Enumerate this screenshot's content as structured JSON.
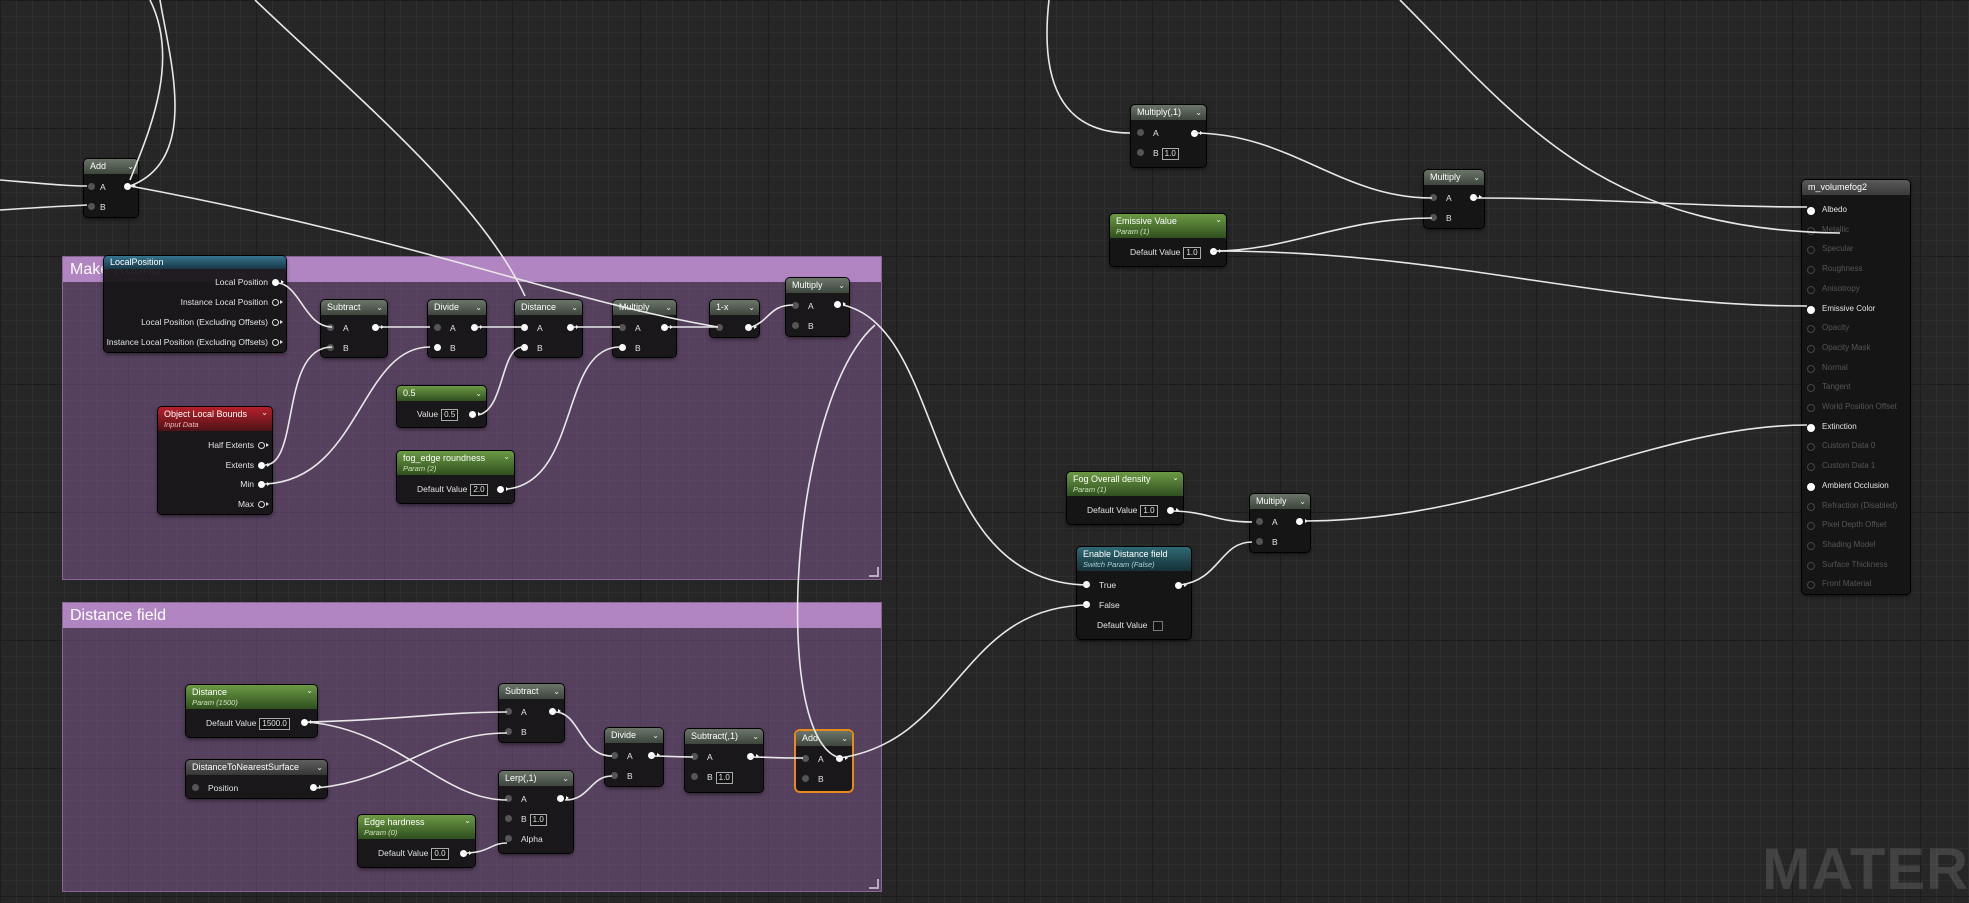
{
  "watermark": "MATER",
  "comments": {
    "make_round": "Make Round",
    "distance_field": "Distance field"
  },
  "nodes": {
    "add_top": {
      "title": "Add",
      "a": "A",
      "b": "B"
    },
    "local_position": {
      "title": "LocalPosition",
      "outputs": [
        "Local Position",
        "Instance Local Position",
        "Local Position (Excluding Offsets)",
        "Instance Local Position (Excluding Offsets)"
      ]
    },
    "subtract1": {
      "title": "Subtract",
      "a": "A",
      "b": "B"
    },
    "divide1": {
      "title": "Divide",
      "a": "A",
      "b": "B"
    },
    "distance1": {
      "title": "Distance",
      "a": "A",
      "b": "B"
    },
    "multiply1": {
      "title": "Multiply",
      "a": "A",
      "b": "B"
    },
    "one_minus": {
      "title": "1-x"
    },
    "multiply2": {
      "title": "Multiply",
      "a": "A",
      "b": "B"
    },
    "const_05": {
      "title": "0.5",
      "label": "Value",
      "value": "0.5"
    },
    "object_bounds": {
      "title": "Object Local Bounds",
      "subtitle": "Input Data",
      "outputs": [
        "Half Extents",
        "Extents",
        "Min",
        "Max"
      ]
    },
    "fog_edge": {
      "title": "fog_edge roundness",
      "subtitle": "Param (2)",
      "label": "Default Value",
      "value": "2.0"
    },
    "distance_param": {
      "title": "Distance",
      "subtitle": "Param (1500)",
      "label": "Default Value",
      "value": "1500.0"
    },
    "dist_nearest": {
      "title": "DistanceToNearestSurface",
      "input": "Position"
    },
    "subtract2": {
      "title": "Subtract",
      "a": "A",
      "b": "B"
    },
    "lerp": {
      "title": "Lerp(,1)",
      "a": "A",
      "b": "B",
      "b_value": "1.0",
      "alpha": "Alpha"
    },
    "divide2": {
      "title": "Divide",
      "a": "A",
      "b": "B"
    },
    "subtract3": {
      "title": "Subtract(,1)",
      "a": "A",
      "b": "B",
      "b_value": "1.0"
    },
    "add_sel": {
      "title": "Add",
      "a": "A",
      "b": "B"
    },
    "edge_hardness": {
      "title": "Edge hardness",
      "subtitle": "Param (0)",
      "label": "Default Value",
      "value": "0.0"
    },
    "multiply_top": {
      "title": "Multiply(,1)",
      "a": "A",
      "b": "B",
      "b_value": "1.0"
    },
    "emissive_value": {
      "title": "Emissive Value",
      "subtitle": "Param (1)",
      "label": "Default Value",
      "value": "1.0"
    },
    "multiply_right": {
      "title": "Multiply",
      "a": "A",
      "b": "B"
    },
    "fog_density": {
      "title": "Fog Overall density",
      "subtitle": "Param (1)",
      "label": "Default Value",
      "value": "1.0"
    },
    "enable_df": {
      "title": "Enable Distance field",
      "subtitle": "Switch Param (False)",
      "true_label": "True",
      "false_label": "False",
      "default_label": "Default Value"
    },
    "multiply_bottom": {
      "title": "Multiply",
      "a": "A",
      "b": "B"
    },
    "material": {
      "title": "m_volumefog2",
      "inputs": [
        {
          "label": "Albedo",
          "connected": true
        },
        {
          "label": "Metallic",
          "connected": false
        },
        {
          "label": "Specular",
          "connected": false
        },
        {
          "label": "Roughness",
          "connected": false
        },
        {
          "label": "Anisotropy",
          "connected": false
        },
        {
          "label": "Emissive Color",
          "connected": true
        },
        {
          "label": "Opacity",
          "connected": false
        },
        {
          "label": "Opacity Mask",
          "connected": false
        },
        {
          "label": "Normal",
          "connected": false
        },
        {
          "label": "Tangent",
          "connected": false
        },
        {
          "label": "World Position Offset",
          "connected": false
        },
        {
          "label": "Extinction",
          "connected": true
        },
        {
          "label": "Custom Data 0",
          "connected": false
        },
        {
          "label": "Custom Data 1",
          "connected": false
        },
        {
          "label": "Ambient Occlusion",
          "connected": true
        },
        {
          "label": "Refraction (Disabled)",
          "connected": false
        },
        {
          "label": "Pixel Depth Offset",
          "connected": false
        },
        {
          "label": "Shading Model",
          "connected": false
        },
        {
          "label": "Surface Thickness",
          "connected": false
        },
        {
          "label": "Front Material",
          "connected": false
        }
      ]
    }
  }
}
